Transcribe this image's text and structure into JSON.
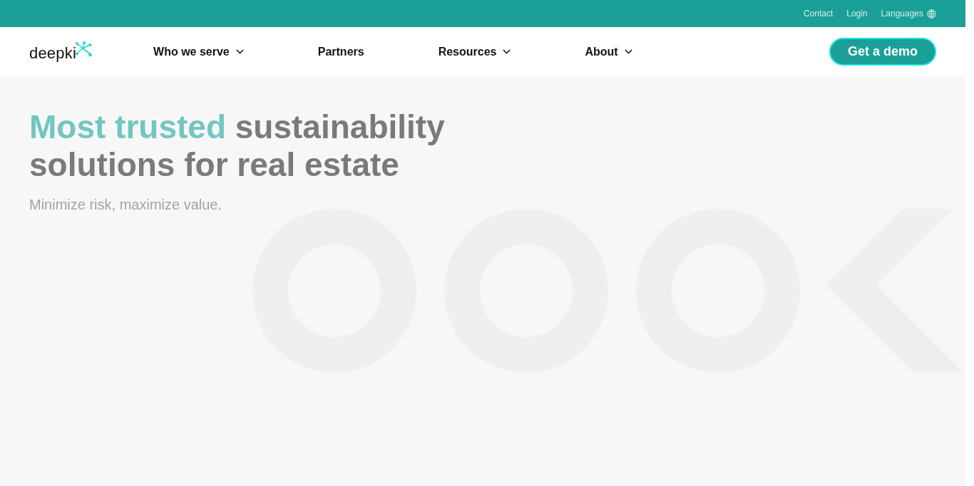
{
  "top_bar": {
    "links": [
      {
        "label": "Contact",
        "kind": "link"
      },
      {
        "label": "Login",
        "kind": "link"
      },
      {
        "label": "Languages",
        "kind": "language"
      }
    ]
  },
  "nav": {
    "logo": "deepki",
    "items": [
      {
        "label": "Who we serve",
        "kind": "dropdown"
      },
      {
        "label": "Partners",
        "kind": "link"
      },
      {
        "label": "Resources",
        "kind": "dropdown"
      },
      {
        "label": "About",
        "kind": "dropdown"
      }
    ],
    "cta": "Get a demo"
  },
  "hero": {
    "headline_highlight": "Most trusted",
    "headline": "sustainability solutions for real estate",
    "subtitle": "Minimize risk, maximize value."
  }
}
